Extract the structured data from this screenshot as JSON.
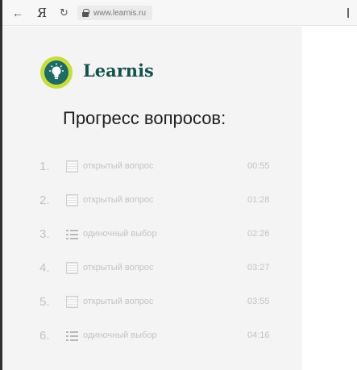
{
  "browser": {
    "back_icon": "arrow-left-icon",
    "yandex_glyph": "Я",
    "reload_icon": "reload-icon",
    "url": "www.learnis.ru"
  },
  "brand": {
    "name": "Learnis",
    "logo_icon": "lightbulb-icon",
    "logo_ring_color": "#c6dd3e",
    "logo_fill_color": "#1f6b63"
  },
  "page": {
    "heading": "Прогресс вопросов:"
  },
  "questions": [
    {
      "num": "1.",
      "type": "открытый вопрос",
      "time": "00:55",
      "icon": "text-lines-icon"
    },
    {
      "num": "2.",
      "type": "открытый вопрос",
      "time": "01:28",
      "icon": "text-lines-icon"
    },
    {
      "num": "3.",
      "type": "одиночный выбор",
      "time": "02:26",
      "icon": "bullet-list-icon"
    },
    {
      "num": "4.",
      "type": "открытый вопрос",
      "time": "03:27",
      "icon": "text-lines-icon"
    },
    {
      "num": "5.",
      "type": "открытый вопрос",
      "time": "03:55",
      "icon": "text-lines-icon"
    },
    {
      "num": "6.",
      "type": "одиночный выбор",
      "time": "04:16",
      "icon": "bullet-list-icon"
    }
  ]
}
